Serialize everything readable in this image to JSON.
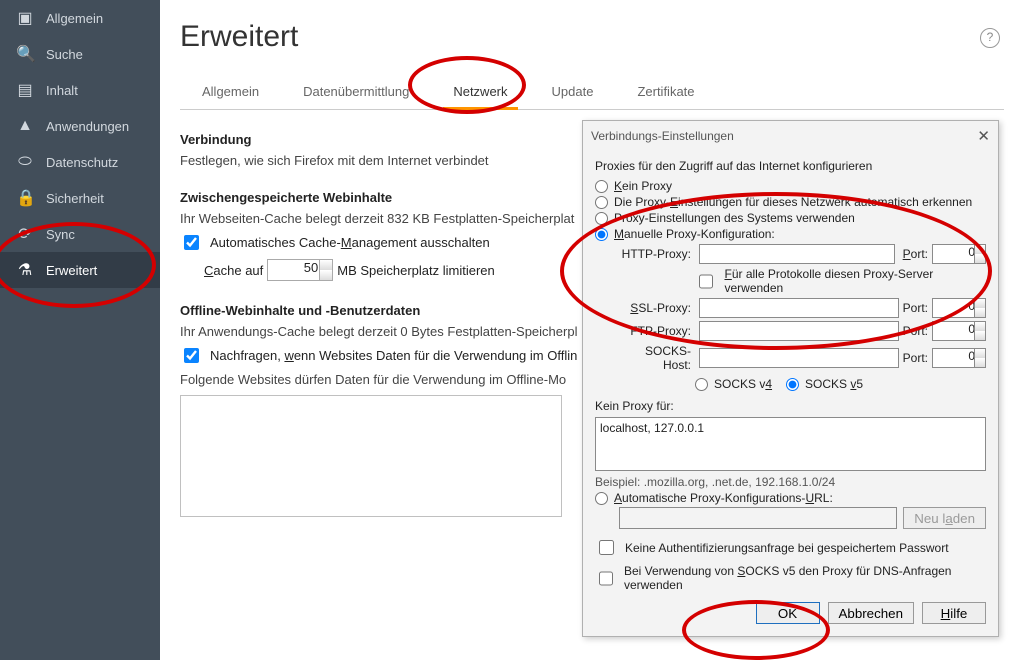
{
  "sidebar": {
    "items": [
      {
        "label": "Allgemein"
      },
      {
        "label": "Suche"
      },
      {
        "label": "Inhalt"
      },
      {
        "label": "Anwendungen"
      },
      {
        "label": "Datenschutz"
      },
      {
        "label": "Sicherheit"
      },
      {
        "label": "Sync"
      },
      {
        "label": "Erweitert"
      }
    ]
  },
  "page": {
    "title": "Erweitert"
  },
  "tabs": {
    "items": [
      {
        "label": "Allgemein"
      },
      {
        "label": "Datenübermittlung"
      },
      {
        "label": "Netzwerk"
      },
      {
        "label": "Update"
      },
      {
        "label": "Zertifikate"
      }
    ],
    "active_index": 2
  },
  "conn": {
    "heading": "Verbindung",
    "desc": "Festlegen, wie sich Firefox mit dem Internet verbindet"
  },
  "cache": {
    "heading": "Zwischengespeicherte Webinhalte",
    "desc": "Ihr Webseiten-Cache belegt derzeit 832 KB Festplatten-Speicherplat",
    "checkbox_pre": "Automatisches Cache-",
    "checkbox_mid": "M",
    "checkbox_post": "anagement ausschalten",
    "row_pre": "C",
    "row_mid": "ache auf",
    "value": "50",
    "row_post": "MB Speicherplatz limitieren"
  },
  "offline": {
    "heading": "Offline-Webinhalte und -Benutzerdaten",
    "desc": "Ihr Anwendungs-Cache belegt derzeit 0 Bytes Festplatten-Speicherpl",
    "checkbox_pre": "Nachfragen, ",
    "checkbox_mid": "w",
    "checkbox_post": "enn Websites Daten für die Verwendung im Offlin",
    "line2": "Folgende Websites dürfen Daten für die Verwendung im Offline-Mo"
  },
  "dialog": {
    "title": "Verbindungs-Einstellungen",
    "heading": "Proxies für den Zugriff auf das Internet konfigurieren",
    "radios": {
      "none_pre": "K",
      "none_mid": "ein Proxy",
      "auto_pre": "Die Proxy-",
      "auto_u": "E",
      "auto_post": "instellungen für dieses Netzwerk automatisch erkennen",
      "sys": "Proxy-Einstellungen des Systems verwenden",
      "manual_pre": "M",
      "manual_mid": "anuelle Proxy-Konfiguration:",
      "pac_pre": "A",
      "pac_mid": "utomatische Proxy-Konfigurations-",
      "pac_u": "U",
      "pac_post": "RL:"
    },
    "fields": {
      "http": "HTTP-Proxy:",
      "port_pre": "P",
      "port_mid": "ort:",
      "port_plain": "Port:",
      "same_pre": "F",
      "same_mid": "ür alle Protokolle diesen Proxy-Server verwenden",
      "ssl_pre": "S",
      "ssl_mid": "SL-Proxy:",
      "ftp": "FTP-Proxy:",
      "socks": "SOCKS-Host:",
      "port0": "0",
      "socks4_pre": "SOCKS v",
      "socks4_u": "4",
      "socks5_pre": "SOCKS ",
      "socks5_u": "v",
      "socks5_post": "5"
    },
    "noproxy": {
      "label": "Kein Proxy für:",
      "value": "localhost, 127.0.0.1",
      "example": "Beispiel: .mozilla.org, .net.de, 192.168.1.0/24"
    },
    "reload_pre": "Neu l",
    "reload_u": "a",
    "reload_post": "den",
    "checks": {
      "noauth": "Keine Authentifizierungsanfrage bei gespeichertem Passwort",
      "dns_pre": "Bei Verwendung von ",
      "dns_u": "S",
      "dns_mid": "OCKS v5 den Proxy für DNS-Anfragen verwenden"
    },
    "buttons": {
      "ok": "OK",
      "cancel": "Abbrechen",
      "help_pre": "H",
      "help_mid": "ilfe"
    }
  }
}
